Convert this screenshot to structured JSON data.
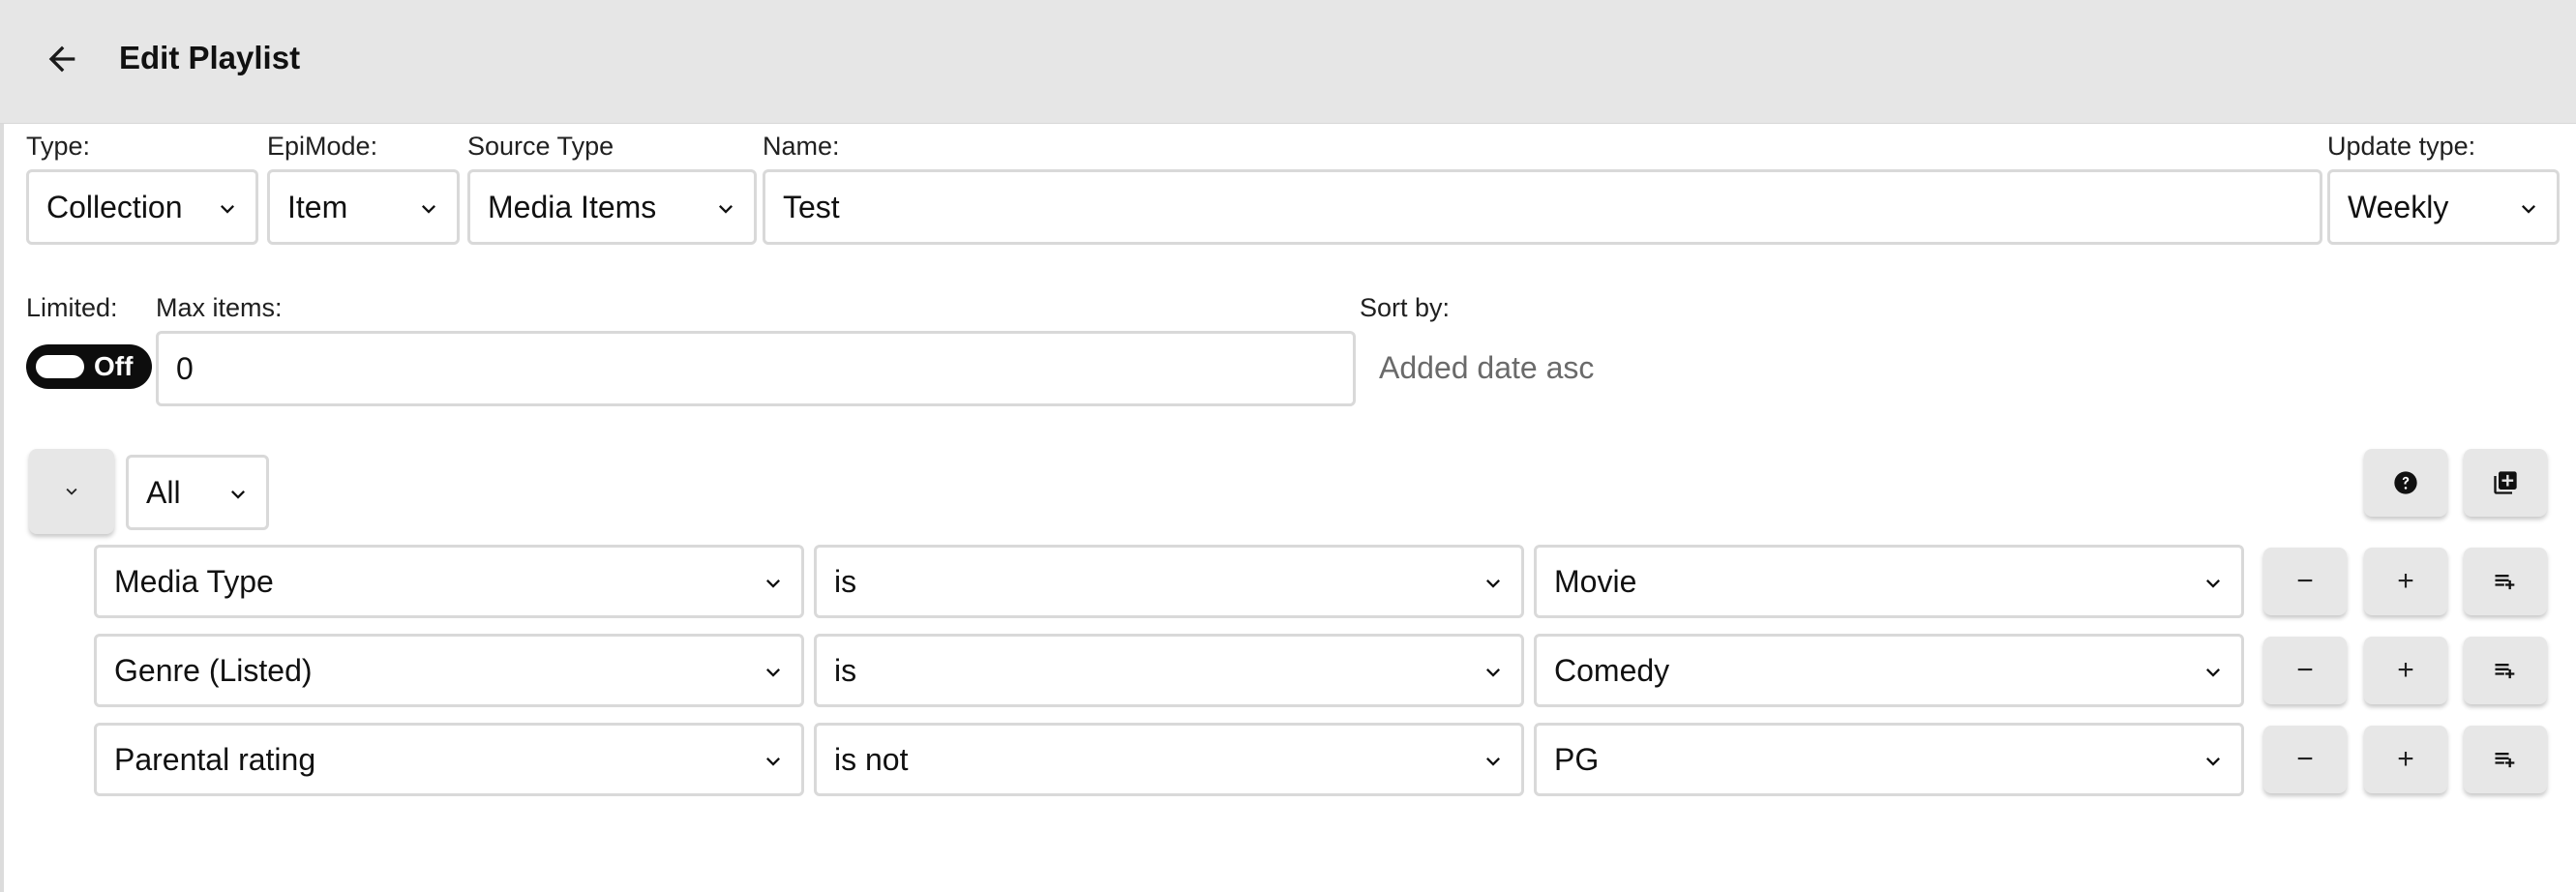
{
  "header": {
    "title": "Edit Playlist",
    "back_icon": "arrow-left-icon"
  },
  "form": {
    "type": {
      "label": "Type:",
      "value": "Collection"
    },
    "epimode": {
      "label": "EpiMode:",
      "value": "Item"
    },
    "source_type": {
      "label": "Source Type",
      "value": "Media Items"
    },
    "name": {
      "label": "Name:",
      "value": "Test"
    },
    "update_type": {
      "label": "Update type:",
      "value": "Weekly"
    },
    "limited": {
      "label": "Limited:",
      "toggle_text": "Off",
      "on": false
    },
    "max_items": {
      "label": "Max items:",
      "value": "0"
    },
    "sort_by": {
      "label": "Sort by:",
      "value": "Added date asc"
    }
  },
  "rules": {
    "group_match": "All",
    "collapse_icon": "chevron-down-icon",
    "help_icon": "help-circle-icon",
    "add_group_icon": "library-add-icon",
    "rows": [
      {
        "field": "Media Type",
        "operator": "is",
        "value": "Movie"
      },
      {
        "field": "Genre (Listed)",
        "operator": "is",
        "value": "Comedy"
      },
      {
        "field": "Parental rating",
        "operator": "is not",
        "value": "PG"
      }
    ],
    "row_buttons": {
      "remove_symbol": "−",
      "add_symbol": "+",
      "add_subgroup_icon": "playlist-add-icon"
    }
  }
}
